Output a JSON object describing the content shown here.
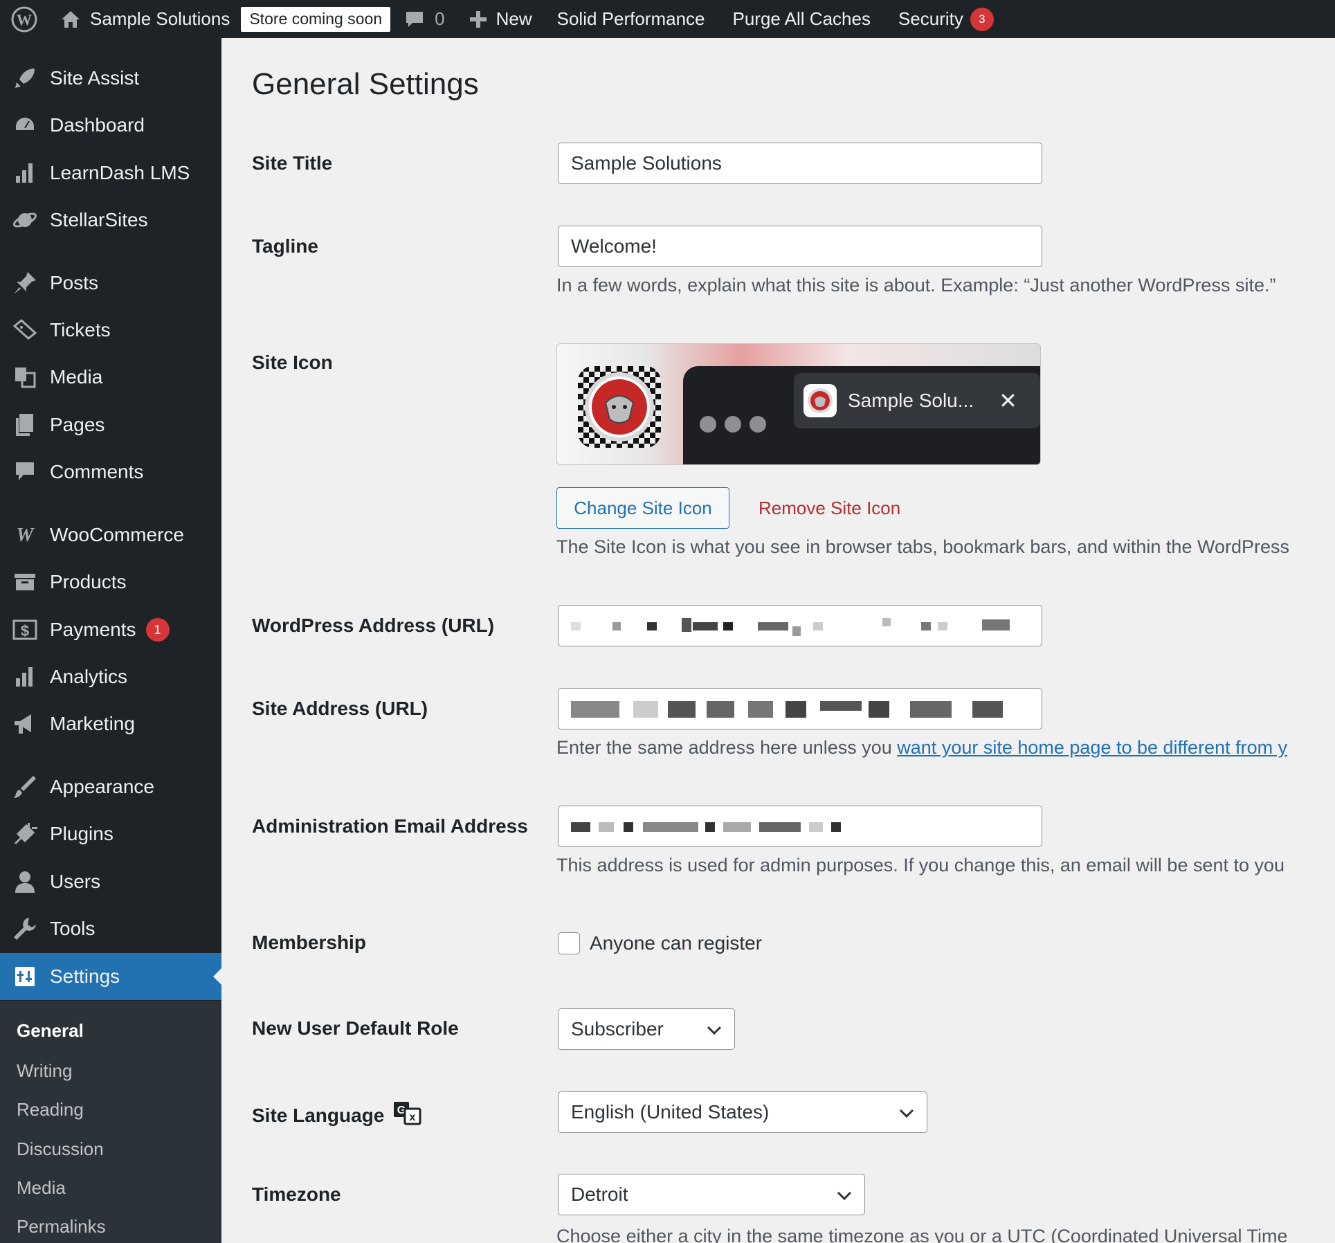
{
  "adminbar": {
    "site_name": "Sample Solutions",
    "store_status": "Store coming soon",
    "comments_count": "0",
    "new_label": "New",
    "items": [
      "Solid Performance",
      "Purge All Caches"
    ],
    "security_label": "Security",
    "security_count": "3"
  },
  "sidebar": {
    "items": [
      {
        "label": "Site Assist",
        "icon": "rocket-icon"
      },
      {
        "label": "Dashboard",
        "icon": "dashboard-icon"
      },
      {
        "label": "LearnDash LMS",
        "icon": "bar-chart-icon"
      },
      {
        "label": "StellarSites",
        "icon": "planet-icon"
      },
      {
        "label": "Posts",
        "icon": "pin-icon"
      },
      {
        "label": "Tickets",
        "icon": "ticket-icon"
      },
      {
        "label": "Media",
        "icon": "media-icon"
      },
      {
        "label": "Pages",
        "icon": "pages-icon"
      },
      {
        "label": "Comments",
        "icon": "comment-icon"
      },
      {
        "label": "WooCommerce",
        "icon": "woo-icon"
      },
      {
        "label": "Products",
        "icon": "archive-icon"
      },
      {
        "label": "Payments",
        "icon": "dollar-icon",
        "badge": "1"
      },
      {
        "label": "Analytics",
        "icon": "bar-chart-icon"
      },
      {
        "label": "Marketing",
        "icon": "megaphone-icon"
      },
      {
        "label": "Appearance",
        "icon": "brush-icon"
      },
      {
        "label": "Plugins",
        "icon": "plug-icon"
      },
      {
        "label": "Users",
        "icon": "user-icon"
      },
      {
        "label": "Tools",
        "icon": "wrench-icon"
      },
      {
        "label": "Settings",
        "icon": "settings-icon"
      }
    ],
    "submenu": [
      "General",
      "Writing",
      "Reading",
      "Discussion",
      "Media",
      "Permalinks"
    ]
  },
  "page": {
    "title": "General Settings",
    "site_title_label": "Site Title",
    "site_title_value": "Sample Solutions",
    "tagline_label": "Tagline",
    "tagline_value": "Welcome!",
    "tagline_desc": "In a few words, explain what this site is about. Example: “Just another WordPress site.”",
    "site_icon_label": "Site Icon",
    "site_icon_tab_title": "Sample Solu...",
    "change_icon_label": "Change Site Icon",
    "remove_icon_label": "Remove Site Icon",
    "site_icon_desc": "The Site Icon is what you see in browser tabs, bookmark bars, and within the WordPress",
    "wp_address_label": "WordPress Address (URL)",
    "site_address_label": "Site Address (URL)",
    "site_address_desc_prefix": "Enter the same address here unless you ",
    "site_address_desc_link": "want your site home page to be different from y",
    "admin_email_label": "Administration Email Address",
    "admin_email_desc": "This address is used for admin purposes. If you change this, an email will be sent to you",
    "membership_label": "Membership",
    "membership_checkbox_label": "Anyone can register",
    "default_role_label": "New User Default Role",
    "default_role_value": "Subscriber",
    "language_label": "Site Language",
    "language_value": "English (United States)",
    "timezone_label": "Timezone",
    "timezone_value": "Detroit",
    "timezone_desc": "Choose either a city in the same timezone as you or a UTC (Coordinated Universal Time"
  },
  "colors": {
    "adminbar_bg": "#1d2327",
    "accent": "#2271b1",
    "badge": "#d63638",
    "delete_link": "#b32d2e"
  }
}
